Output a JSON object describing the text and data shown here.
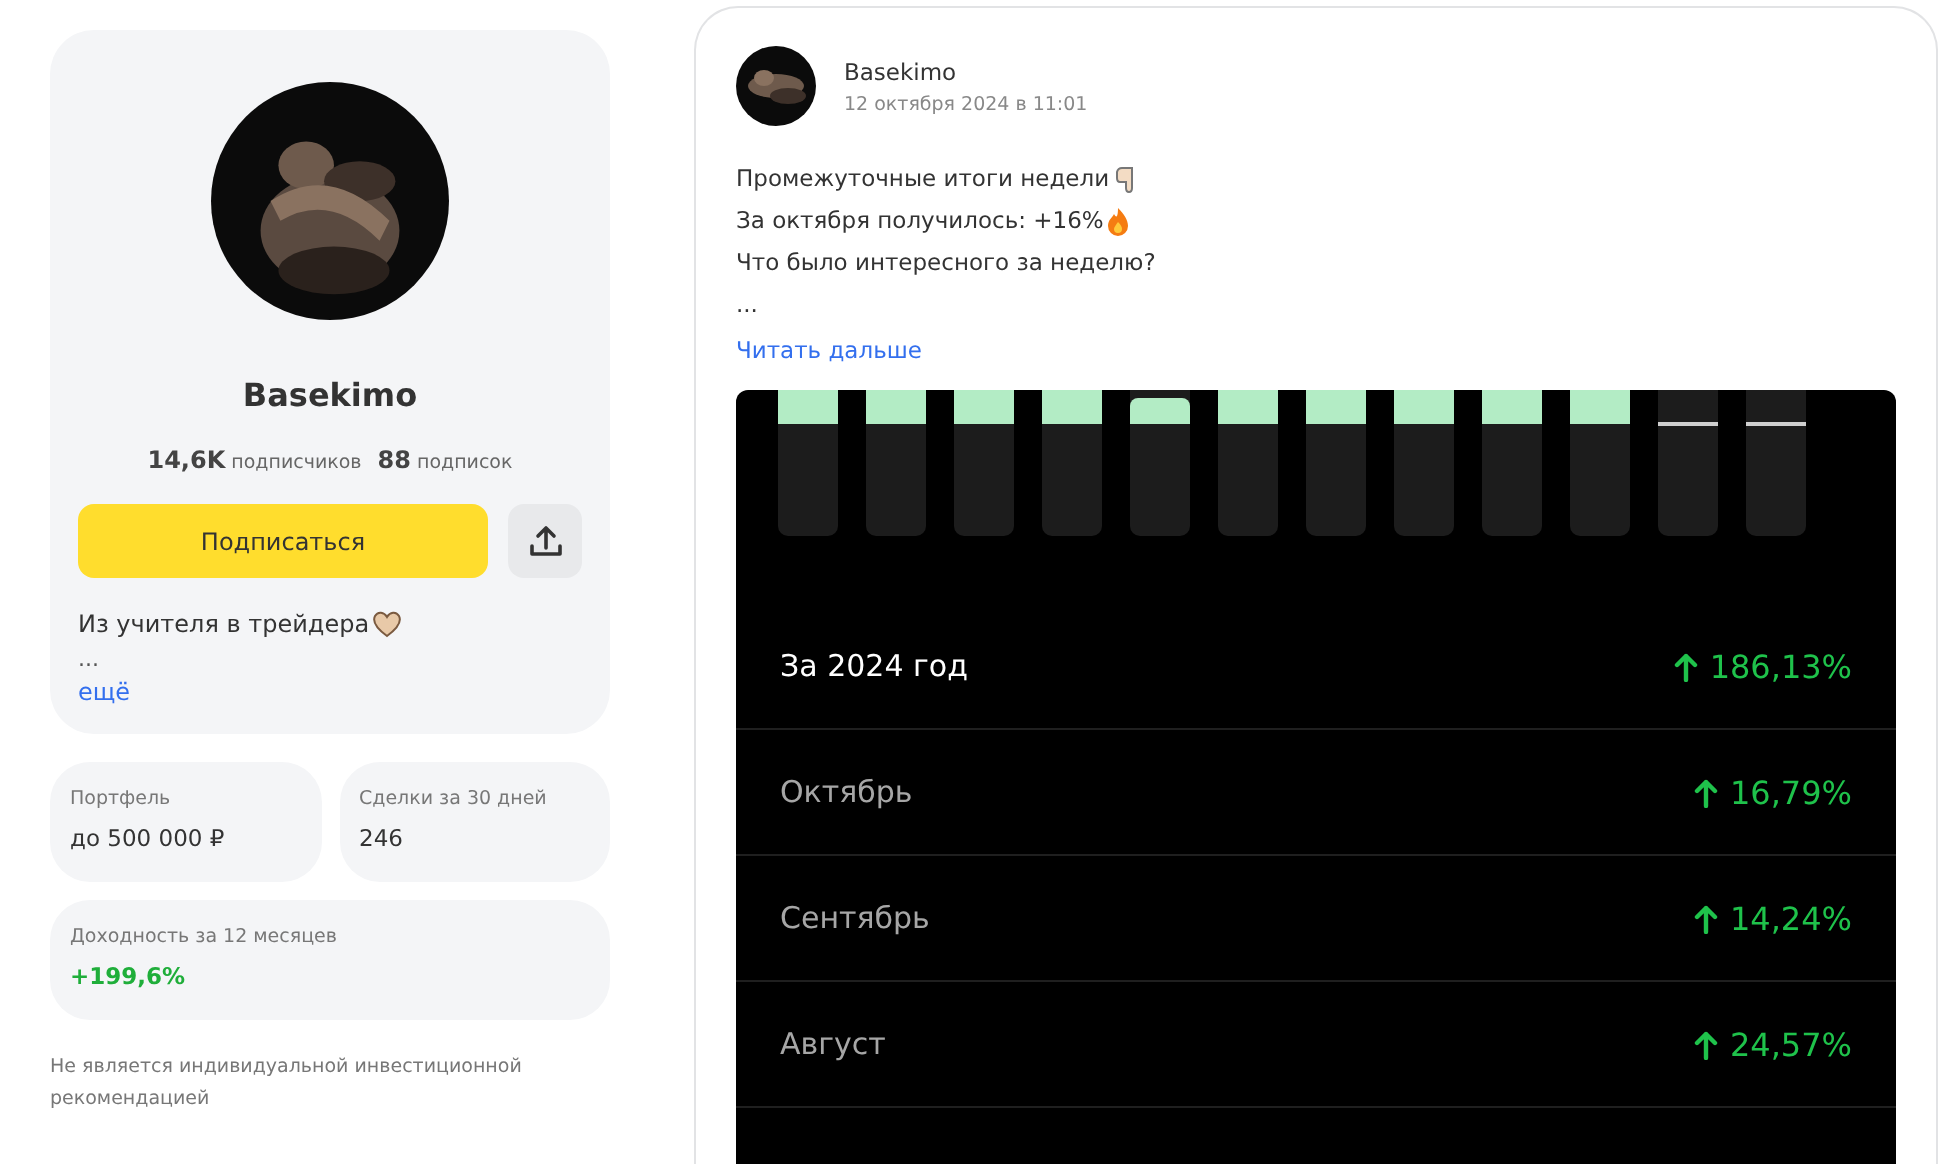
{
  "profile": {
    "name": "Basekimo",
    "followers_count": "14,6K",
    "followers_label": "подписчиков",
    "following_count": "88",
    "following_label": "подписок",
    "subscribe_button": "Подписаться",
    "bio": "Из учителя в трейдера",
    "bio_more": "...",
    "more_link": "ещё"
  },
  "stats": [
    {
      "label": "Портфель",
      "value": "до 500 000 ₽",
      "kind": "plain"
    },
    {
      "label": "Сделки за 30 дней",
      "value": "246",
      "kind": "plain"
    },
    {
      "label": "Доходность за 12 месяцев",
      "value": "+199,6%",
      "kind": "gain"
    }
  ],
  "disclaimer": "Не является индивидуальной инвестиционной рекомендацией",
  "post": {
    "author": "Basekimo",
    "date": "12 октября 2024 в 11:01",
    "lines": [
      {
        "text": "Промежуточные итоги недели",
        "kind": "hand"
      },
      {
        "text": "За октября получилось: +16%",
        "kind": "fire"
      },
      {
        "text": "Что было интересного за неделю?",
        "kind": "plain"
      },
      {
        "text": "...",
        "kind": "plain"
      }
    ],
    "read_more": "Читать дальше",
    "screenshot": {
      "bars": [
        {
          "kind": "gain"
        },
        {
          "kind": "gain"
        },
        {
          "kind": "gain"
        },
        {
          "kind": "gain"
        },
        {
          "kind": "gain-low"
        },
        {
          "kind": "gain"
        },
        {
          "kind": "gain"
        },
        {
          "kind": "gain"
        },
        {
          "kind": "gain"
        },
        {
          "kind": "gain"
        },
        {
          "kind": "flat"
        },
        {
          "kind": "flat"
        }
      ],
      "rows": [
        {
          "label": "За 2024 год",
          "value": "186,13%",
          "selected": true
        },
        {
          "label": "Октябрь",
          "value": "16,79%",
          "selected": false
        },
        {
          "label": "Сентябрь",
          "value": "14,24%",
          "selected": false
        },
        {
          "label": "Август",
          "value": "24,57%",
          "selected": false
        }
      ]
    }
  }
}
